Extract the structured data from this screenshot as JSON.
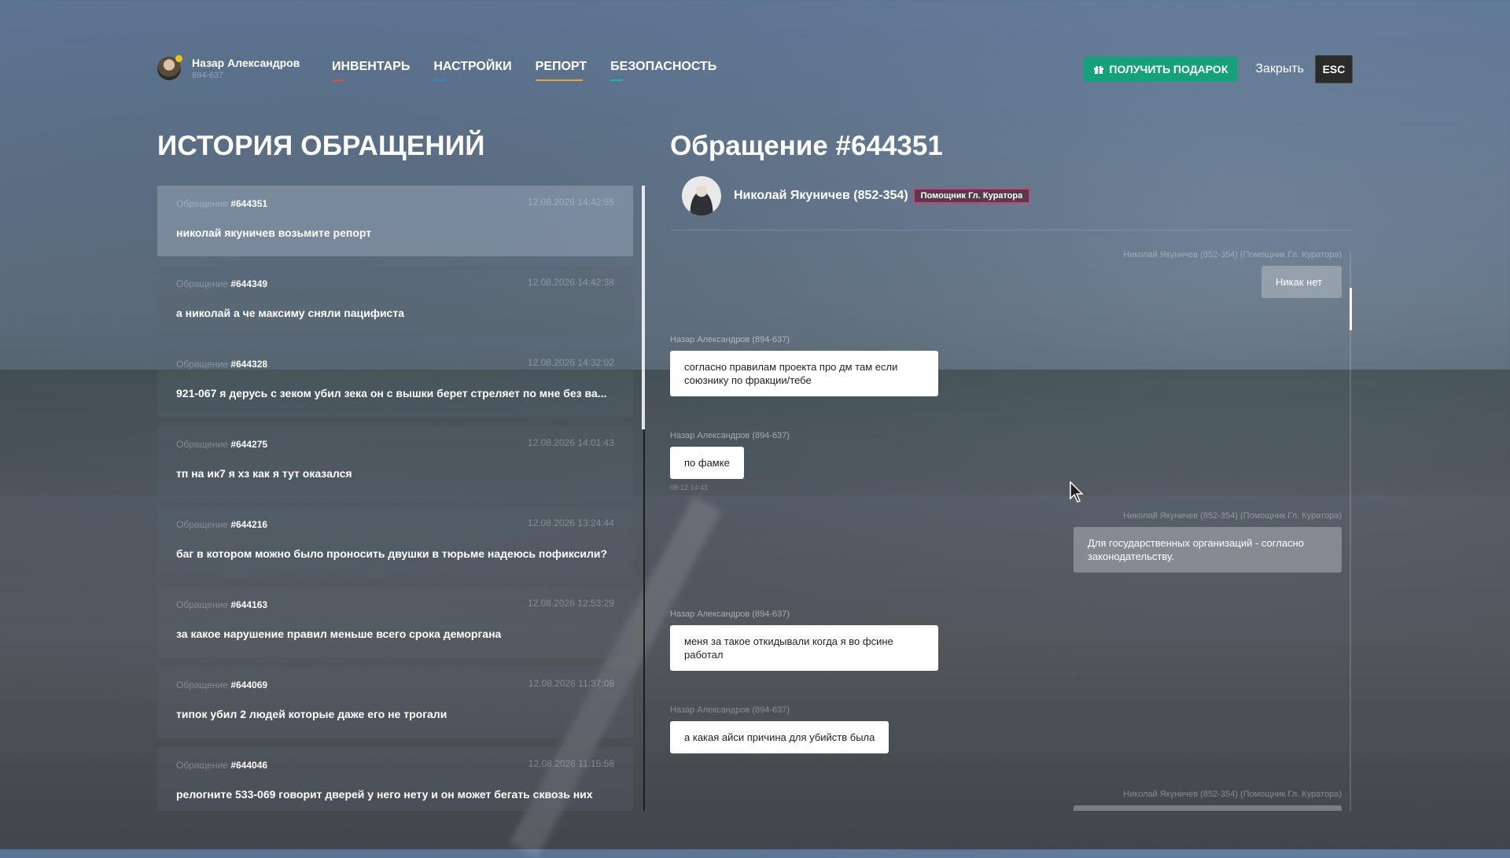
{
  "user": {
    "name": "Назар Александров",
    "id": "894-637"
  },
  "nav": [
    {
      "label": "ИНВЕНТАРЬ",
      "color": "#e74c3c",
      "active": false
    },
    {
      "label": "НАСТРОЙКИ",
      "color": "#2a8fbf",
      "active": false
    },
    {
      "label": "РЕПОРТ",
      "color": "#e6a23c",
      "active": true
    },
    {
      "label": "БЕЗОПАСНОСТЬ",
      "color": "#1abc9c",
      "active": false
    }
  ],
  "controls": {
    "gift_label": "ПОЛУЧИТЬ ПОДАРОК",
    "close_label": "Закрыть",
    "esc_label": "ESC"
  },
  "history": {
    "title": "ИСТОРИЯ ОБРАЩЕНИЙ",
    "tickets": [
      {
        "label": "Обращение",
        "number": "#644351",
        "date": "12.08.2026 14:42:55",
        "text": "николай якуничев возьмите репорт"
      },
      {
        "label": "Обращение",
        "number": "#644349",
        "date": "12.08.2026 14:42:38",
        "text": "а николай а че максиму сняли пацифиста"
      },
      {
        "label": "Обращение",
        "number": "#644328",
        "date": "12.08.2026 14:32:02",
        "text": "921-067 я дерусь с зеком убил зека он с вышки берет стреляет по мне без ва..."
      },
      {
        "label": "Обращение",
        "number": "#644275",
        "date": "12.08.2026 14:01:43",
        "text": "тп на ик7 я хз как я тут оказался"
      },
      {
        "label": "Обращение",
        "number": "#644216",
        "date": "12.08.2026 13:24:44",
        "text": "баг в котором можно было проносить двушки в тюрьме надеюсь пофиксили?"
      },
      {
        "label": "Обращение",
        "number": "#644163",
        "date": "12.08.2026 12:53:29",
        "text": "за какое нарушение правил меньше всего срока деморгана"
      },
      {
        "label": "Обращение",
        "number": "#644069",
        "date": "12.08.2026 11:37:08",
        "text": "типок убил 2 людей которые даже его не трогали"
      },
      {
        "label": "Обращение",
        "number": "#644046",
        "date": "12.08.2026 11:15:58",
        "text": "релогните 533-069 говорит дверей у него нету и он может бегать сквозь них"
      }
    ]
  },
  "request": {
    "title": "Обращение #644351",
    "assignee_name": "Николай Якуничев (852-354)",
    "assignee_role": "Помощник Гл. Куратора",
    "messages": [
      {
        "side": "right",
        "author": "Николай Якуничев (852-354) (Помощник Гл. Куратора)",
        "text": "Никак нет"
      },
      {
        "side": "left",
        "author": "Назар Александров (894-637)",
        "text": "согласно правилам проекта про дм там если союзнику по фракции/тебе"
      },
      {
        "side": "left",
        "author": "Назар Александров (894-637)",
        "text": "по фамке",
        "time": "08-12 14:43"
      },
      {
        "side": "right",
        "author": "Николай Якуничев (852-354) (Помощник Гл. Куратора)",
        "text": "Для государственных организаций - согласно законодательству."
      },
      {
        "side": "left",
        "author": "Назар Александров (894-637)",
        "text": "меня за такое откидывали когда я во фсине работал"
      },
      {
        "side": "left",
        "author": "Назар Александров (894-637)",
        "text": "а какая айси причина для убийств была"
      },
      {
        "side": "right",
        "author": "Николай Якуничев (852-354) (Помощник Гл. Куратора)",
        "text": ""
      }
    ]
  },
  "icons": {
    "gift": "gift-icon",
    "cursor": "mouse-cursor-icon"
  }
}
